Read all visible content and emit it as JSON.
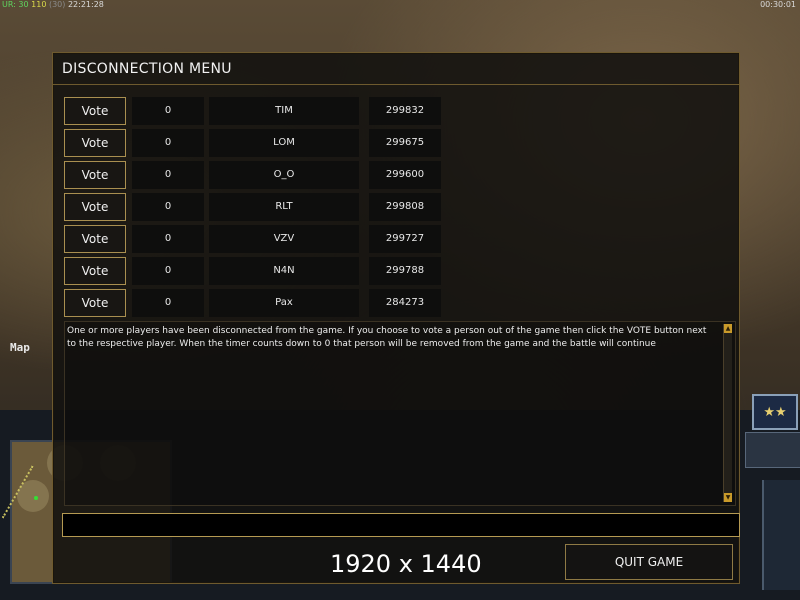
{
  "hud": {
    "fps_prefix": "UR: 30",
    "fps_mid": "110",
    "fps_dim": "(30)",
    "fps_time": "22:21:28",
    "clock": "00:30:01",
    "map_label": "Map"
  },
  "dialog": {
    "title": "DISCONNECTION MENU",
    "players": [
      {
        "vote_label": "Vote",
        "votes": "0",
        "name": "TIM",
        "ping": "299832"
      },
      {
        "vote_label": "Vote",
        "votes": "0",
        "name": "LOM",
        "ping": "299675"
      },
      {
        "vote_label": "Vote",
        "votes": "0",
        "name": "O_O",
        "ping": "299600"
      },
      {
        "vote_label": "Vote",
        "votes": "0",
        "name": "RLT",
        "ping": "299808"
      },
      {
        "vote_label": "Vote",
        "votes": "0",
        "name": "VZV",
        "ping": "299727"
      },
      {
        "vote_label": "Vote",
        "votes": "0",
        "name": "N4N",
        "ping": "299788"
      },
      {
        "vote_label": "Vote",
        "votes": "0",
        "name": "Pax",
        "ping": "284273"
      }
    ],
    "message": "One or more players have been disconnected from the game. If you choose to vote a person out of the game then click the VOTE button next to the respective player. When the timer counts down to 0 that person will be removed from the game and the battle will continue",
    "chat_value": "",
    "quit_label": "QUIT GAME"
  },
  "overlay": {
    "resolution_text": "1920 x 1440"
  },
  "colors": {
    "dialog_border": "#6e5a2e",
    "button_border": "#a98f50",
    "scroll_accent": "#c99a2a"
  }
}
